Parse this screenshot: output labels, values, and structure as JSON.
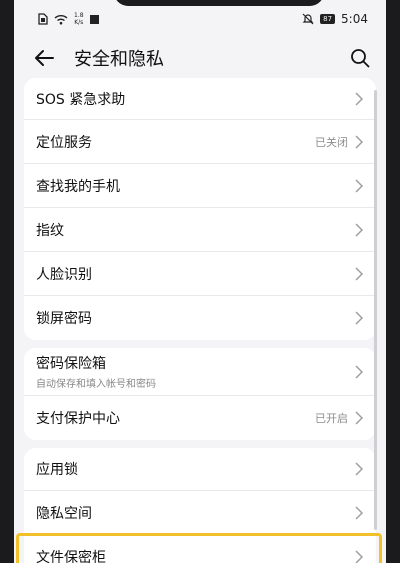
{
  "status_bar": {
    "net_speed_value": "1.8",
    "net_speed_unit": "K/s",
    "battery": "87",
    "time": "5:04"
  },
  "header": {
    "title": "安全和隐私"
  },
  "groups": [
    {
      "items": [
        {
          "label": "SOS 紧急求助",
          "value": ""
        },
        {
          "label": "定位服务",
          "value": "已关闭"
        },
        {
          "label": "查找我的手机",
          "value": ""
        },
        {
          "label": "指纹",
          "value": ""
        },
        {
          "label": "人脸识别",
          "value": ""
        },
        {
          "label": "锁屏密码",
          "value": ""
        }
      ]
    },
    {
      "items": [
        {
          "label": "密码保险箱",
          "sub": "自动保存和填入帐号和密码",
          "value": ""
        },
        {
          "label": "支付保护中心",
          "value": "已开启"
        }
      ]
    },
    {
      "items": [
        {
          "label": "应用锁",
          "value": ""
        },
        {
          "label": "隐私空间",
          "value": ""
        },
        {
          "label": "文件保密柜",
          "value": ""
        }
      ]
    }
  ],
  "colors": {
    "highlight": "#f2c028",
    "background": "#f4f4f6"
  }
}
